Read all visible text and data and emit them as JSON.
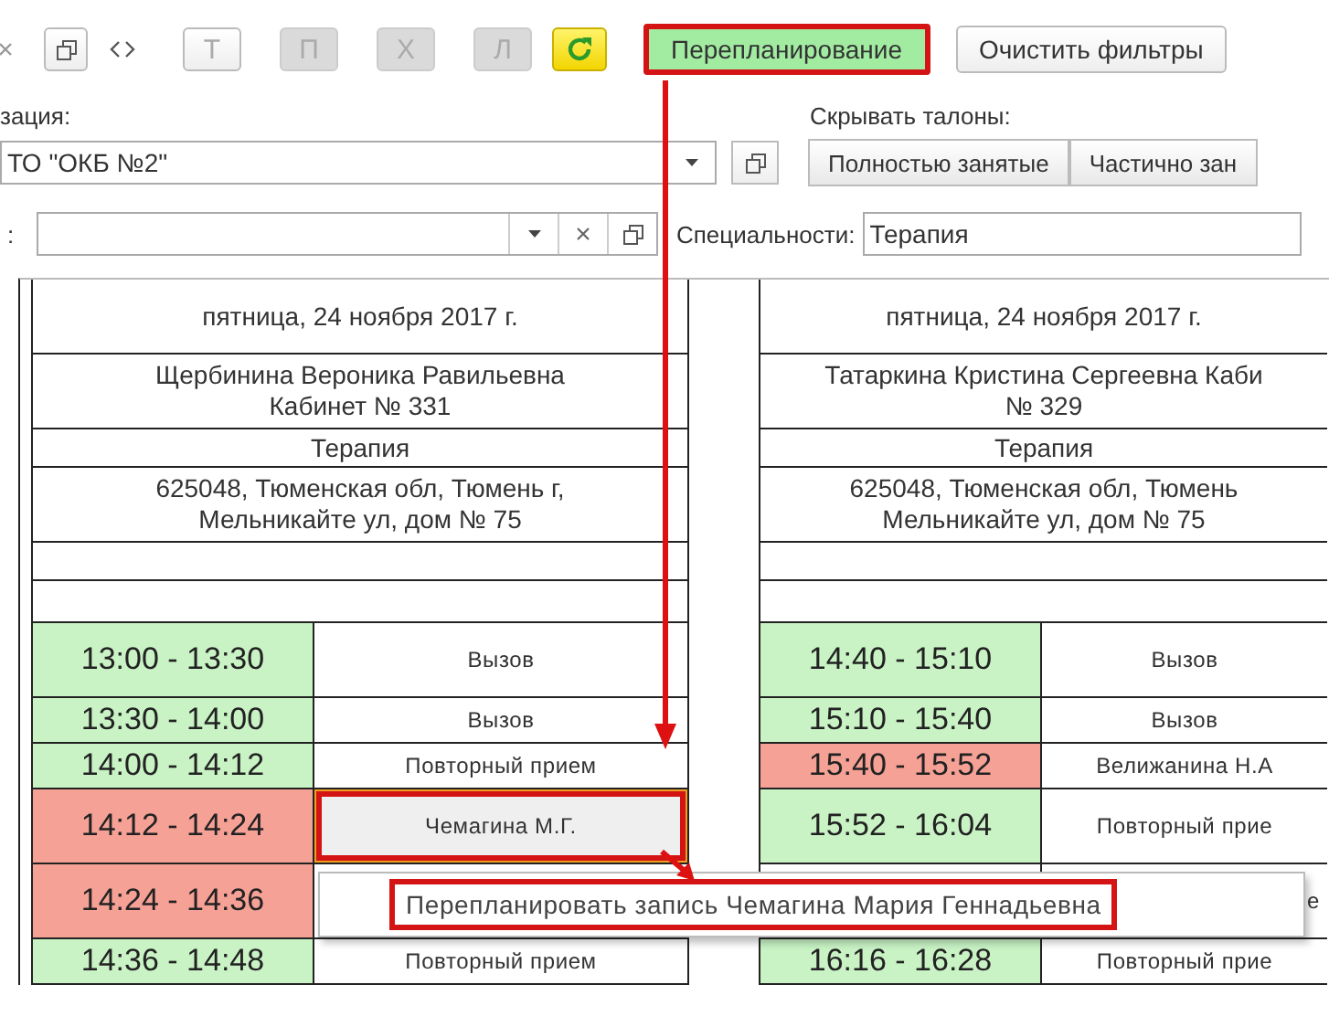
{
  "toolbar": [
    {
      "kind": "close"
    },
    {
      "kind": "copy"
    },
    {
      "kind": "nav"
    },
    {
      "kind": "letter",
      "text": "Т",
      "disabled": false
    },
    {
      "kind": "letter",
      "text": "П",
      "disabled": true
    },
    {
      "kind": "letter",
      "text": "Х",
      "disabled": true
    },
    {
      "kind": "letter",
      "text": "Л",
      "disabled": true
    },
    {
      "kind": "refresh"
    },
    {
      "kind": "text",
      "text": "Перепланирование",
      "active": true,
      "highlighted": true
    },
    {
      "kind": "text",
      "text": "Очистить фильтры",
      "active": false,
      "highlighted": false
    }
  ],
  "filters": {
    "organization": {
      "label": "зация:",
      "value": "ТО \"ОКБ №2\""
    },
    "hide_tickets": {
      "label": "Скрывать талоны:",
      "buttons": [
        "Полностью занятые",
        "Частично зан"
      ]
    },
    "second": {
      "label": ":"
    },
    "specialties": {
      "label": "Специальности:",
      "value": "Терапия"
    }
  },
  "schedule": [
    {
      "date": "пятница, 24 ноября 2017 г.",
      "doctor": "Щербинина Вероника Равильевна\nКабинет № 331",
      "specialty": "Терапия",
      "address": "625048, Тюменская обл, Тюмень г,\nМельникайте ул, дом № 75",
      "slots": [
        {
          "time": "13:00 - 13:30",
          "booked": false,
          "label": "Вызов",
          "selected": false
        },
        {
          "time": "13:30 - 14:00",
          "booked": false,
          "label": "Вызов",
          "selected": false
        },
        {
          "time": "14:00 - 14:12",
          "booked": false,
          "label": "Повторный прием",
          "selected": false
        },
        {
          "time": "14:12 - 14:24",
          "booked": true,
          "label": "Чемагина М.Г.",
          "selected": true,
          "highlighted": true
        },
        {
          "time": "14:24 - 14:36",
          "booked": true
        },
        {
          "time": "14:36 - 14:48",
          "booked": false,
          "label": "Повторный прием",
          "selected": false
        }
      ]
    },
    {
      "date": "пятница, 24 ноября 2017 г.",
      "doctor": "Татаркина Кристина Сергеевна Каби\n№ 329",
      "specialty": "Терапия",
      "address": "625048, Тюменская обл, Тюмень\nМельникайте ул, дом № 75",
      "slots": [
        {
          "time": "14:40 - 15:10",
          "booked": false,
          "label": "Вызов",
          "selected": false
        },
        {
          "time": "15:10 - 15:40",
          "booked": false,
          "label": "Вызов",
          "selected": false
        },
        {
          "time": "15:40 - 15:52",
          "booked": true,
          "label": "Велижанина Н.А",
          "selected": false
        },
        {
          "time": "15:52 - 16:04",
          "booked": false,
          "label": "Повторный прие",
          "selected": false
        },
        {
          "label": "е",
          "selected": false
        },
        {
          "time": "16:16 - 16:28",
          "booked": false,
          "label": "Повторный прие",
          "selected": false
        }
      ]
    }
  ],
  "context_menu": {
    "item": "Перепланировать запись Чемагина Мария Геннадьевна",
    "highlighted": true
  }
}
